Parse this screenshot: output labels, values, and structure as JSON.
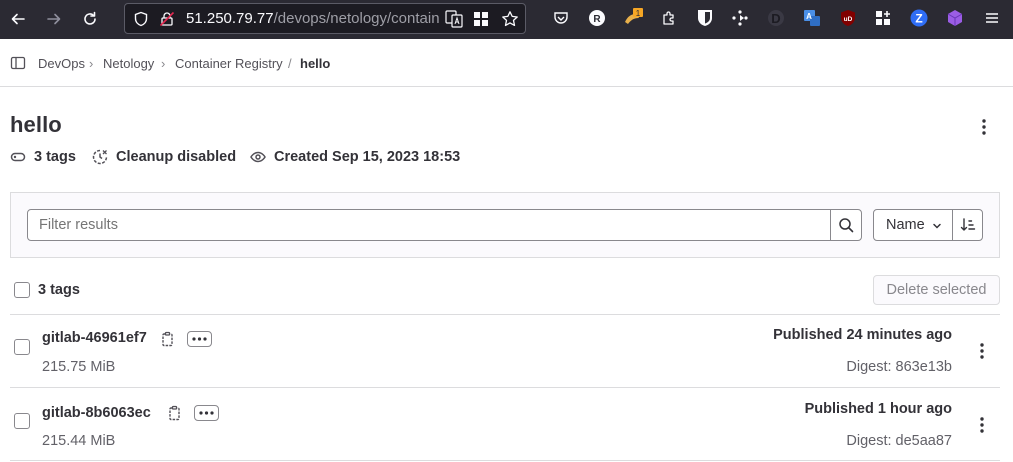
{
  "browser": {
    "url_main": "51.250.79.77",
    "url_path": "/devops/netology/contain",
    "extension_badge": "1"
  },
  "breadcrumb": {
    "items": [
      "DevOps",
      "Netology",
      "Container Registry"
    ],
    "current": "hello",
    "separator_1": "›",
    "separator_2": "›",
    "separator_3": "/"
  },
  "page": {
    "title": "hello",
    "meta": {
      "tags": "3 tags",
      "cleanup": "Cleanup disabled",
      "created": "Created Sep 15, 2023 18:53"
    }
  },
  "filter": {
    "placeholder": "Filter results",
    "sort_label": "Name"
  },
  "list": {
    "select_all_label": "3 tags",
    "delete_selected_label": "Delete selected",
    "rows": [
      {
        "name": "gitlab-46961ef7",
        "size": "215.75 MiB",
        "published": "Published 24 minutes ago",
        "digest": "Digest: 863e13b"
      },
      {
        "name": "gitlab-8b6063ec",
        "size": "215.44 MiB",
        "published": "Published 1 hour ago",
        "digest": "Digest: de5aa87"
      }
    ]
  },
  "colors": {
    "browser_bg": "#2b2a33",
    "text_primary": "#333238",
    "text_secondary": "#626168",
    "border": "#dcdcde",
    "panel_bg": "#fbfafd"
  },
  "icons": {
    "sidebar_toggle": "sidebar-toggle-icon",
    "tag": "label-icon",
    "cleanup": "clock-cross-icon",
    "created": "eye-icon",
    "search": "search-icon",
    "sort_direction": "sort-lowest-icon",
    "copy": "copy-to-clipboard-icon",
    "more": "ellipsis-icon",
    "kebab": "kebab-menu-icon"
  }
}
